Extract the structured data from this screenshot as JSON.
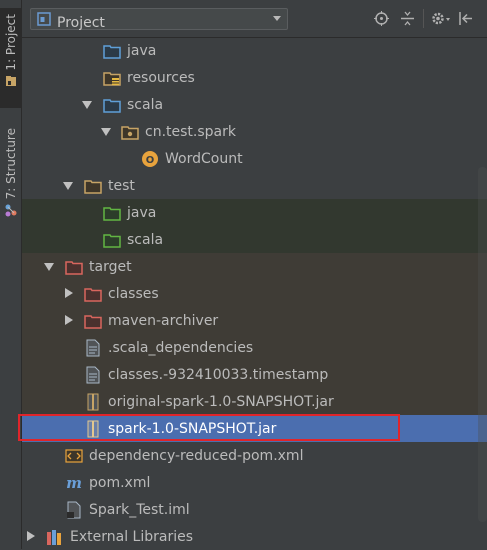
{
  "tool_strip": {
    "project_tab": "1: Project",
    "structure_tab": "7: Structure"
  },
  "header": {
    "view_selector": "Project",
    "icons": [
      "locate-icon",
      "collapse-all-icon",
      "gear-icon",
      "hide-panel-icon"
    ]
  },
  "tree": {
    "rows": [
      {
        "label": "java",
        "icon": "folder-blue"
      },
      {
        "label": "resources",
        "icon": "folder-resources"
      },
      {
        "label": "scala",
        "icon": "folder-blue",
        "expanded": true
      },
      {
        "label": "cn.test.spark",
        "icon": "package",
        "expanded": true
      },
      {
        "label": "WordCount",
        "icon": "scala-object"
      },
      {
        "label": "test",
        "icon": "folder",
        "expanded": true
      },
      {
        "label": "java",
        "icon": "folder-green"
      },
      {
        "label": "scala",
        "icon": "folder-green"
      },
      {
        "label": "target",
        "icon": "folder-red",
        "expanded": true
      },
      {
        "label": "classes",
        "icon": "folder-red",
        "expanded": false
      },
      {
        "label": "maven-archiver",
        "icon": "folder-red",
        "expanded": false
      },
      {
        "label": ".scala_dependencies",
        "icon": "file-text"
      },
      {
        "label": "classes.-932410033.timestamp",
        "icon": "file-text"
      },
      {
        "label": "original-spark-1.0-SNAPSHOT.jar",
        "icon": "jar"
      },
      {
        "label": "spark-1.0-SNAPSHOT.jar",
        "icon": "jar",
        "selected": true
      },
      {
        "label": "dependency-reduced-pom.xml",
        "icon": "xml"
      },
      {
        "label": "pom.xml",
        "icon": "maven"
      },
      {
        "label": "Spark_Test.iml",
        "icon": "iml"
      },
      {
        "label": "External Libraries",
        "icon": "libraries",
        "expanded": false
      }
    ]
  },
  "colors": {
    "selection": "#4b6eaf",
    "highlight_border": "#e0252b",
    "folder_blue": "#5f9fd8",
    "folder_green": "#62b543",
    "folder_red": "#d9665e",
    "folder_brown": "#c7a466"
  }
}
